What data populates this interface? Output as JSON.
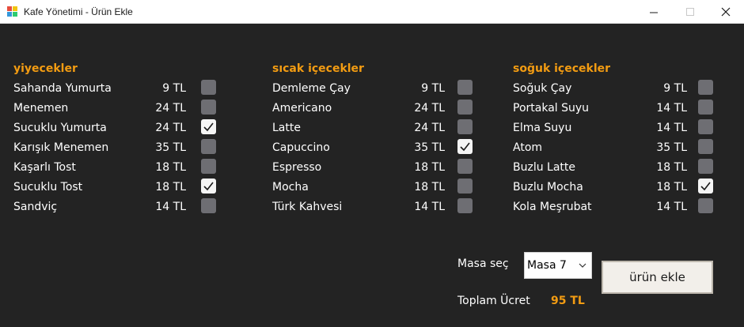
{
  "window": {
    "title": "Kafe Yönetimi - Ürün Ekle",
    "controls": {
      "minimize": "—",
      "maximize": "☐",
      "close": "✕"
    }
  },
  "colors": {
    "accent": "#f39c12",
    "background": "#232323",
    "checkbox": "#6e6e73"
  },
  "columns": [
    {
      "header": "yiyecekler",
      "items": [
        {
          "name": "Sahanda Yumurta",
          "price": "9 TL",
          "checked": false
        },
        {
          "name": "Menemen",
          "price": "24 TL",
          "checked": false
        },
        {
          "name": "Sucuklu Yumurta",
          "price": "24 TL",
          "checked": true
        },
        {
          "name": "Karışık Menemen",
          "price": "35 TL",
          "checked": false
        },
        {
          "name": "Kaşarlı Tost",
          "price": "18 TL",
          "checked": false
        },
        {
          "name": "Sucuklu Tost",
          "price": "18 TL",
          "checked": true
        },
        {
          "name": "Sandviç",
          "price": "14 TL",
          "checked": false
        }
      ]
    },
    {
      "header": "sıcak içecekler",
      "items": [
        {
          "name": "Demleme Çay",
          "price": "9 TL",
          "checked": false
        },
        {
          "name": "Americano",
          "price": "24 TL",
          "checked": false
        },
        {
          "name": "Latte",
          "price": "24 TL",
          "checked": false
        },
        {
          "name": "Capuccino",
          "price": "35 TL",
          "checked": true
        },
        {
          "name": "Espresso",
          "price": "18 TL",
          "checked": false
        },
        {
          "name": "Mocha",
          "price": "18 TL",
          "checked": false
        },
        {
          "name": "Türk Kahvesi",
          "price": "14 TL",
          "checked": false
        }
      ]
    },
    {
      "header": "soğuk içecekler",
      "items": [
        {
          "name": "Soğuk Çay",
          "price": "9 TL",
          "checked": false
        },
        {
          "name": "Portakal Suyu",
          "price": "14 TL",
          "checked": false
        },
        {
          "name": "Elma Suyu",
          "price": "14 TL",
          "checked": false
        },
        {
          "name": "Atom",
          "price": "35 TL",
          "checked": false
        },
        {
          "name": "Buzlu Latte",
          "price": "18 TL",
          "checked": false
        },
        {
          "name": "Buzlu Mocha",
          "price": "18 TL",
          "checked": true
        },
        {
          "name": "Kola Meşrubat",
          "price": "14 TL",
          "checked": false
        }
      ]
    }
  ],
  "table_select": {
    "label": "Masa seç",
    "value": "Masa 7"
  },
  "add_button": {
    "label": "ürün ekle"
  },
  "total": {
    "label": "Toplam Ücret",
    "value": "95 TL"
  }
}
